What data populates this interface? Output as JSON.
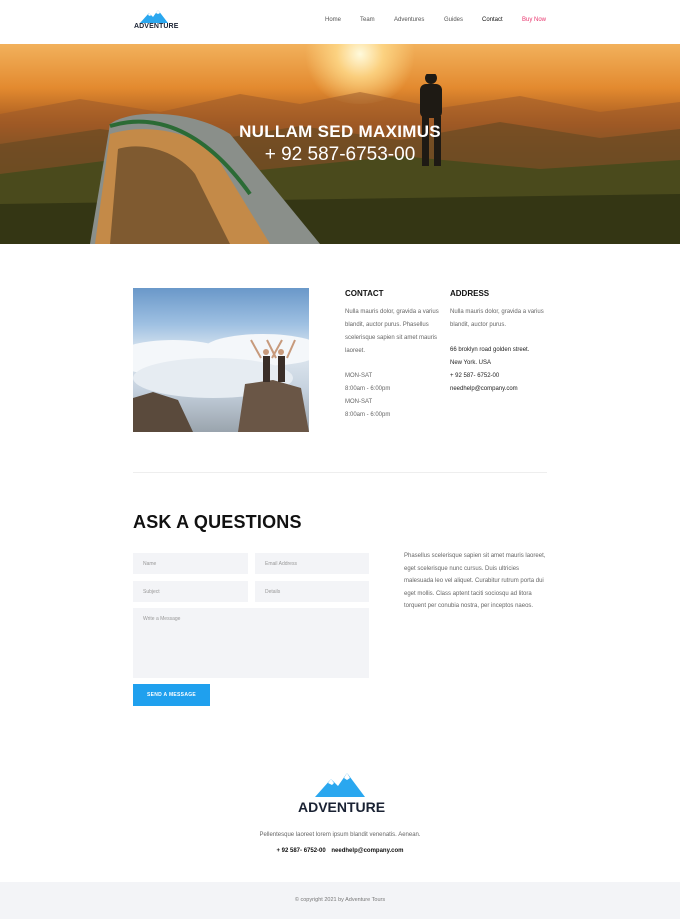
{
  "brand": {
    "name": "ADVENTURE",
    "accent": "#1fa0ee",
    "pink": "#e8356d"
  },
  "nav": {
    "items": [
      {
        "label": "Home"
      },
      {
        "label": "Team"
      },
      {
        "label": "Adventures"
      },
      {
        "label": "Guides"
      },
      {
        "label": "Contact"
      },
      {
        "label": "Buy Now"
      }
    ]
  },
  "hero": {
    "title": "NULLAM SED MAXIMUS",
    "phone": "+ 92 587-6753-00"
  },
  "contact": {
    "title": "CONTACT",
    "text": "Nulla mauris dolor, gravida a varius blandit, auctor purus. Phasellus scelerisque sapien sit amet mauris laoreet.",
    "hours": [
      {
        "days": "MON-SAT",
        "time": "8:00am - 6:00pm"
      },
      {
        "days": "MON-SAT",
        "time": "8:00am - 6:00pm"
      }
    ]
  },
  "address": {
    "title": "ADDRESS",
    "text": "Nulla mauris dolor, gravida a varius blandit, auctor purus.",
    "street": "66 broklyn road golden street.",
    "city": "New York. USA",
    "phone": "+ 92 587- 6752-00",
    "email": "needhelp@company.com"
  },
  "form": {
    "title": "ASK A QUESTIONS",
    "name_placeholder": "Name",
    "email_placeholder": "Email Address",
    "subject_placeholder": "Subject",
    "details_placeholder": "Details",
    "message_placeholder": "Write a Message",
    "send_label": "SEND A MESSAGE",
    "side_text": "Phasellus scelerisque sapien sit amet mauris laoreet, eget scelerisque nunc cursus. Duis ultricies malesuada leo vel aliquet. Curabitur rutrum porta dui eget mollis. Class aptent taciti sociosqu ad litora torquent per conubia nostra, per inceptos naeos."
  },
  "footer": {
    "logo": "ADVENTURE",
    "tagline": "Pellentesque laoreet lorem ipsum blandit venenatis. Aenean.",
    "phone": "+ 92 587- 6752-00",
    "email": "needhelp@company.com",
    "copyright": "© copyright 2021 by Adventure Tours"
  },
  "icons": [
    "mountain-logo-icon"
  ]
}
